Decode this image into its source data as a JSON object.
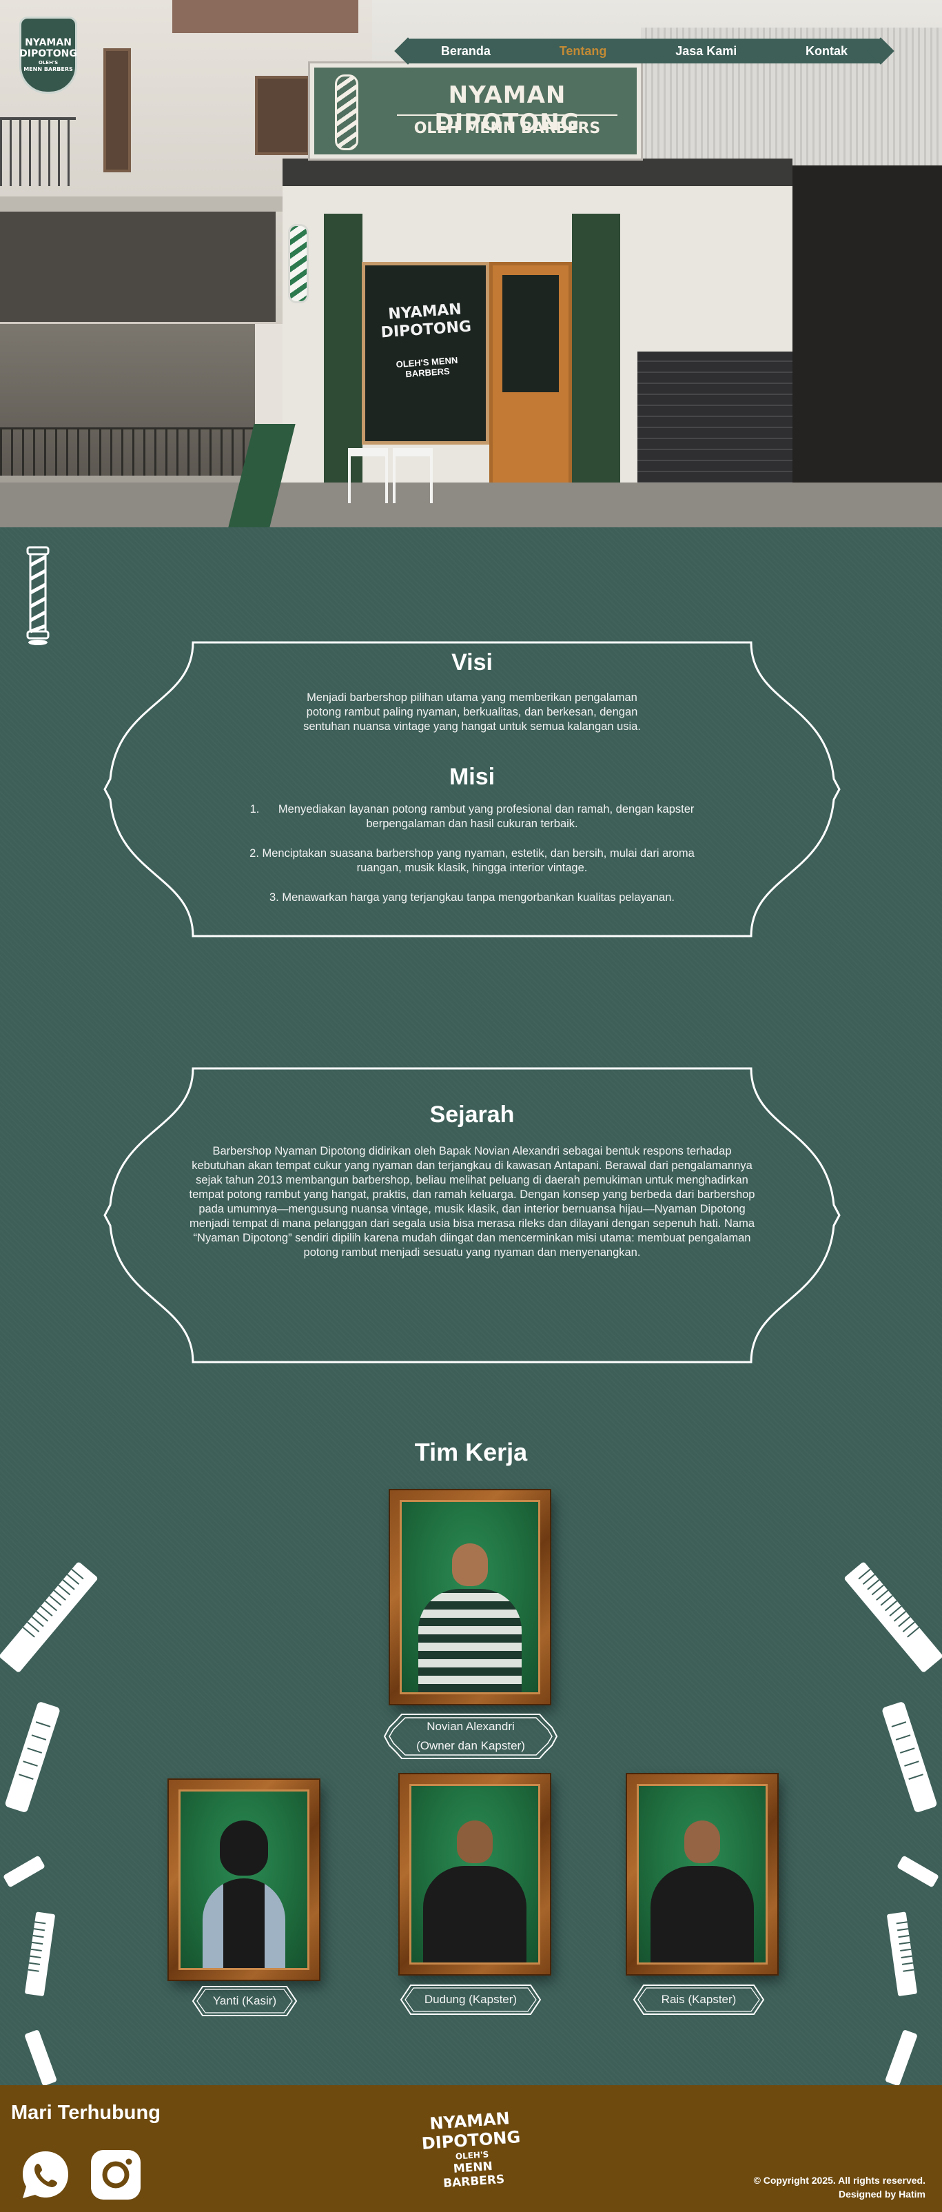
{
  "logo": {
    "line1": "NYAMAN",
    "line2": "DIPOTONG",
    "line3": "OLEH'S",
    "line4": "MENN BARBERS"
  },
  "nav": {
    "items": [
      {
        "label": "Beranda"
      },
      {
        "label": "Tentang"
      },
      {
        "label": "Jasa Kami"
      },
      {
        "label": "Kontak"
      }
    ],
    "active": "Tentang",
    "active_color": "#c38a35"
  },
  "hero": {
    "sign_title": "NYAMAN DIPOTONG",
    "sign_sub": "OLEH MENN BARBERS",
    "window_text": "NYAMAN DIPOTONG",
    "window_sub": "OLEH'S MENN BARBERS"
  },
  "visi": {
    "title": "Visi",
    "text": "Menjadi barbershop pilihan utama yang memberikan pengalaman potong rambut paling nyaman, berkualitas, dan berkesan, dengan sentuhan nuansa vintage yang hangat untuk semua kalangan usia."
  },
  "misi": {
    "title": "Misi",
    "items": [
      "1.      Menyediakan layanan potong rambut yang profesional dan ramah, dengan kapster berpengalaman dan hasil cukuran terbaik.",
      "2. Menciptakan suasana barbershop yang nyaman, estetik, dan bersih, mulai dari aroma ruangan, musik klasik, hingga interior vintage.",
      "3. Menawarkan harga yang terjangkau tanpa mengorbankan kualitas pelayanan."
    ]
  },
  "sejarah": {
    "title": "Sejarah",
    "text": "Barbershop Nyaman Dipotong didirikan oleh Bapak Novian Alexandri sebagai bentuk respons terhadap kebutuhan akan tempat cukur yang nyaman dan terjangkau di kawasan Antapani. Berawal dari pengalamannya sejak tahun 2013 membangun barbershop, beliau melihat peluang di daerah pemukiman untuk menghadirkan tempat potong rambut yang hangat, praktis, dan ramah keluarga. Dengan konsep yang berbeda dari barbershop pada umumnya—mengusung nuansa vintage, musik klasik, dan interior bernuansa hijau—Nyaman Dipotong menjadi tempat di mana pelanggan dari segala usia bisa merasa rileks dan dilayani dengan sepenuh hati. Nama “Nyaman Dipotong” sendiri dipilih karena mudah diingat dan mencerminkan misi utama: membuat pengalaman potong rambut menjadi sesuatu yang nyaman dan menyenangkan."
  },
  "team": {
    "title": "Tim Kerja",
    "members": [
      {
        "name": "Novian Alexandri",
        "role": "(Owner dan Kapster)"
      },
      {
        "name": "Yanti (Kasir)"
      },
      {
        "name": "Dudung (Kapster)"
      },
      {
        "name": "Rais (Kapster)"
      }
    ]
  },
  "footer": {
    "connect": "Mari Terhubung",
    "icons": [
      "whatsapp-icon",
      "instagram-icon"
    ],
    "logo_line1": "NYAMAN",
    "logo_line2": "DIPOTONG",
    "logo_line3": "OLEH'S",
    "logo_line4": "MENN BARBERS",
    "copyright": "© Copyright 2025. All rights reserved.",
    "designed": "Designed by Hatim",
    "bg_color": "#6e4a0f"
  },
  "colors": {
    "page_bg": "#3d5f58",
    "accent": "#c38a35"
  }
}
